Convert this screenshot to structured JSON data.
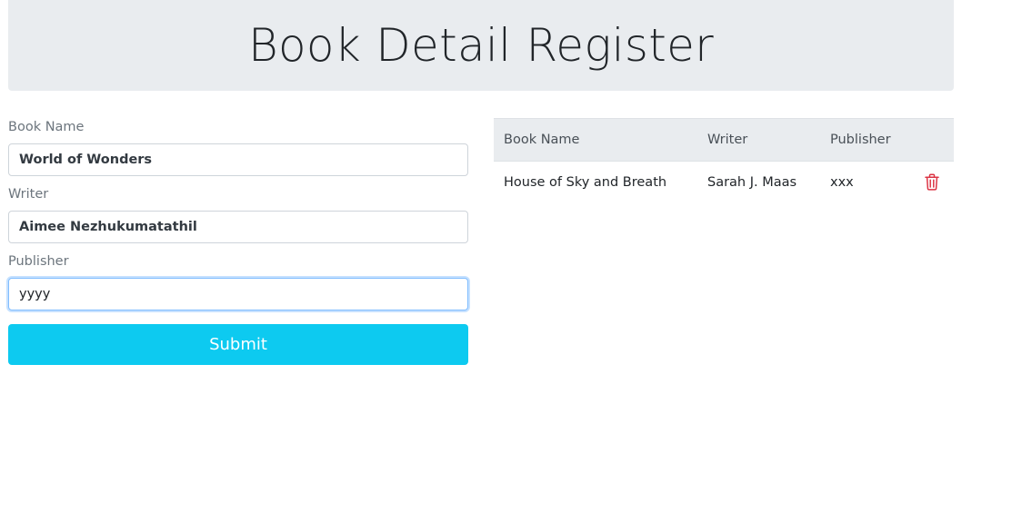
{
  "header": {
    "title": "Book Detail Register"
  },
  "form": {
    "book_name": {
      "label": "Book Name",
      "value": "World of Wonders"
    },
    "writer": {
      "label": "Writer",
      "value": "Aimee Nezhukumatathil"
    },
    "publisher": {
      "label": "Publisher",
      "value": "yyyy"
    },
    "submit_label": "Submit"
  },
  "table": {
    "headers": [
      "Book Name",
      "Writer",
      "Publisher",
      ""
    ],
    "rows": [
      {
        "book_name": "House of Sky and Breath",
        "writer": "Sarah J. Maas",
        "publisher": "xxx",
        "action_icon": "trash-icon"
      }
    ]
  },
  "colors": {
    "header_bg": "#e9ecef",
    "submit_bg": "#0dcaf0",
    "delete_icon": "#dc3545",
    "focus_border": "#80bdff"
  }
}
